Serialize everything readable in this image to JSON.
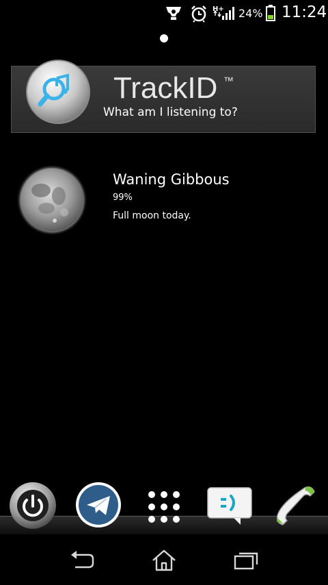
{
  "status_bar": {
    "battery_percent": "24%",
    "time": "11:24",
    "network_type": "H+",
    "icons": [
      "sony-support-icon",
      "alarm-clock-icon",
      "signal-icon",
      "battery-icon"
    ]
  },
  "home": {
    "page_indicator_icon": "page-dot-icon"
  },
  "trackid_widget": {
    "title": "TrackID",
    "trademark": "™",
    "subtitle": "What am I listening to?",
    "icon": "trackid-magnifier-music-icon"
  },
  "moon_widget": {
    "phase": "Waning Gibbous",
    "illumination": "99%",
    "note": "Full moon today.",
    "icon": "moon-icon"
  },
  "dock": {
    "items": [
      {
        "name": "power",
        "icon": "power-icon"
      },
      {
        "name": "telegram",
        "icon": "telegram-plane-icon"
      },
      {
        "name": "app-drawer",
        "icon": "app-grid-icon"
      },
      {
        "name": "messaging",
        "icon": "messaging-bubble-icon"
      },
      {
        "name": "phone",
        "icon": "phone-handset-icon"
      }
    ]
  },
  "nav_bar": {
    "buttons": [
      {
        "name": "back",
        "icon": "back-arrow-icon"
      },
      {
        "name": "home",
        "icon": "home-icon"
      },
      {
        "name": "recents",
        "icon": "recents-icon"
      }
    ]
  },
  "colors": {
    "background": "#000000",
    "battery_level": "#7fd321",
    "telegram_blue": "#2f5d89",
    "messaging_accent": "#1aa7c7",
    "phone_green": "#7cc242",
    "trackid_blue": "#3bb3e8"
  }
}
